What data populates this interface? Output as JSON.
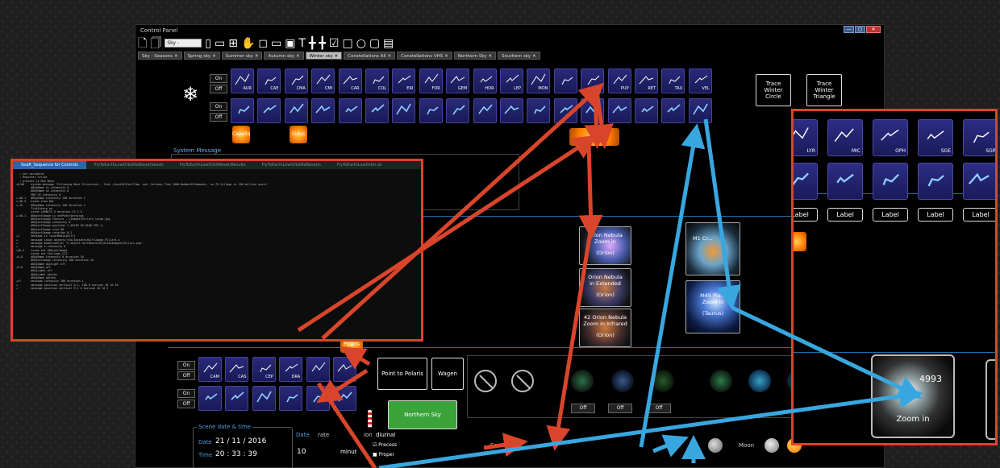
{
  "window": {
    "title": "Control Panel",
    "buttons": [
      "—",
      "▢",
      "✕"
    ]
  },
  "toolbar": {
    "preset_select": "Sky - Seasons"
  },
  "tabs": [
    {
      "label": "Sky - Seasons",
      "active": false
    },
    {
      "label": "Spring sky",
      "active": false
    },
    {
      "label": "Summer sky",
      "active": false
    },
    {
      "label": "Autumn sky",
      "active": false
    },
    {
      "label": "Winter sky",
      "active": true
    },
    {
      "label": "Constellations All",
      "active": false
    },
    {
      "label": "Constellations VHS",
      "active": false
    },
    {
      "label": "Northern Sky",
      "active": false
    },
    {
      "label": "Southern sky",
      "active": false
    }
  ],
  "winter": {
    "on_label": "On",
    "off_label": "Off",
    "constellations": [
      "AUR",
      "CAE",
      "CMA",
      "CMI",
      "CAR",
      "COL",
      "ERI",
      "FOR",
      "GEM",
      "HOR",
      "LEP",
      "MON",
      "",
      "PIC",
      "PUP",
      "RET",
      "TAU",
      "VEL"
    ],
    "trace_circle": "Trace Winter Circle",
    "trace_triangle": "Trace Winter Triangle",
    "stars": [
      "Capella",
      "Sirius"
    ]
  },
  "system_message": {
    "label": "System Message"
  },
  "code_window": {
    "tabs": [
      "SeqR_Sequence for Controls",
      "FlyToEarthLowOrbitNoReset/Seeds",
      "FlyToEarthLowOrbitReset/Results",
      "FlyToEarthLowOrbitNoReset/s",
      "FlyToEarthLowOrbit.ds"
    ],
    "lines": [
      "  ; set variables",
      "  ; Register Script",
      "  ; prevent 11 Min Back",
      "",
      "+0:00    system message \"Following Next Structures - from -CountOfStartTime- and -Solimey Then 1000-NumberOfCommand-- so 7D Collage is 100 million years\"",
      "",
      "         #ObjName ss intensity 0",
      "         #ObjName ss intensity 0",
      "         PNS 3S intensity 0",
      "",
      "+:46.1   #ObjName intensity 100 duration 1",
      "",
      "+:46.5   scene view Hot",
      "",
      "+:12     #ObjName intensity 100 duration 1",
      "         TickInterp on",
      "         scene LORBITS 5 duration 23 2.5",
      "",
      "+:48.1   #ObjectImage is setPath<Settings",
      "         #ObjectImage Texture ..\\Images\\Pillars_large.jpg",
      "         #ObjectImage intensity 0",
      "         #ObjectImage position 1.46139 50.0180 355 1;",
      "         #ObjectImage size 60",
      "         #ObjectImage rotation 0.2",
      "",
      "+1       message is localMedia[Hilt]",
      "+        message input objects:\\HiltAssets\\Hilt\\Image_Pillars.s",
      "+        message modelcontrol 'e object.HiltMuscinfo\\GuideImages\\Pillars.png'",
      "+        message 1 intensity 0",
      "",
      "+46.1    scene set #ObjectImage",
      "         scene set Ceilings_CCZ",
      "+4.8     #ObjName intensity 0 duration 10",
      "         #ObjectImage intensity 100 duration 10",
      "         #ObjName daylight off",
      "+3:0     #ObjName off",
      "         #ObjLabel off",
      "",
      "         #ObjLabel obtnSn",
      "         #ObjName obtnSn",
      "+fl      message intensity 100 duration 1",
      "+        message position vertical 0.1, 180 0 horizon 10 10 10",
      "+        message position vertical 9.1 0 horizon 10 10 2"
    ]
  },
  "dso": {
    "orion1": [
      "Orion Nebula",
      "Zoom in",
      "",
      "(Orion)"
    ],
    "orion2": [
      "Orion Nebula",
      "in Extended",
      "",
      "(Orion)"
    ],
    "orion3": [
      "42 Orion Nebula",
      "Zoom in Infrared",
      "",
      "(Orion)"
    ],
    "m1": "M1 Cr...",
    "m45": [
      "M45 Ple...",
      "Zoom in",
      "",
      "(Taurus)"
    ]
  },
  "zoom_panel": {
    "tiles_top": [
      "LYR",
      "MIC",
      "OPH",
      "SGE",
      "SGR"
    ],
    "label_text": "Label",
    "galaxy_number": "4993",
    "galaxy_sub": "Zoom in"
  },
  "northern": {
    "on_label": "On",
    "off_label": "Off",
    "constellations": [
      "CAM",
      "CAS",
      "CEP",
      "DRA",
      "",
      ""
    ],
    "polaris": "Point to Polaris",
    "wagen": "Wagen",
    "northern_sky": "Northern Sky",
    "polaris_star": "Polaris"
  },
  "filters": {
    "off_labels": [
      "Off",
      "Off",
      "Off"
    ]
  },
  "scene": {
    "title": "Scene date & time",
    "date_label": "Date",
    "date_value": "21 / 11 / 2016",
    "time_label": "Time",
    "time_value": "20 : 33 : 39"
  },
  "rate": {
    "date_label": "Date",
    "rate_label": "rate",
    "motion_label": "ion",
    "motion_value": "diurnal",
    "rate_value": "10",
    "unit": "minut",
    "precess": "Precess",
    "proper": "Proper"
  },
  "bottom_labels": {
    "sat": "Sa",
    "moon": "Moon"
  },
  "colors": {
    "accent_blue": "#1e8fd6",
    "arrow_red": "#d9452b",
    "arrow_blue": "#38a7e0",
    "tile_blue": "#22226e",
    "green_button": "#3aa33a"
  }
}
